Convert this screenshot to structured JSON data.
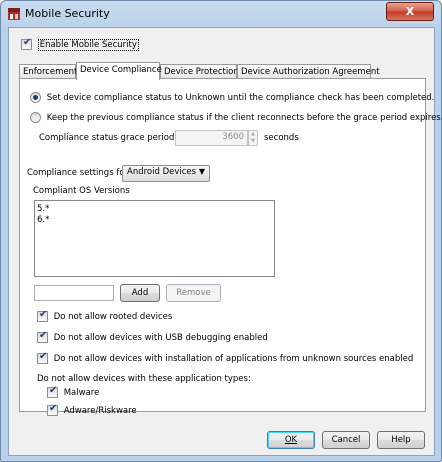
{
  "window": {
    "title": "Mobile Security",
    "close_glyph": "X"
  },
  "enable_checkbox": {
    "label": "Enable Mobile Security",
    "checked": true
  },
  "tabs": [
    {
      "label": "Enforcement",
      "active": false
    },
    {
      "label": "Device Compliance",
      "active": true
    },
    {
      "label": "Device Protection",
      "active": false
    },
    {
      "label": "Device Authorization Agreement",
      "active": false
    }
  ],
  "compliance": {
    "radio_unknown_label": "Set device compliance status to Unknown until the compliance check has been completed.",
    "radio_unknown_selected": true,
    "radio_keep_label": "Keep the previous compliance status if the client reconnects before the grace period expires.",
    "radio_keep_selected": false,
    "grace_label": "Compliance status grace period",
    "grace_value": "3600",
    "grace_unit": "seconds",
    "settings_for_label": "Compliance settings for",
    "settings_for_value": "Android Devices",
    "os_versions_label": "Compliant OS Versions",
    "os_versions": [
      "5.*",
      "6.*"
    ],
    "new_version_value": "",
    "add_label": "Add",
    "remove_label": "Remove",
    "options": [
      {
        "label": "Do not allow rooted devices",
        "checked": true
      },
      {
        "label": "Do not allow devices with USB debugging enabled",
        "checked": true
      },
      {
        "label": "Do not allow devices with installation of applications from unknown sources enabled",
        "checked": true
      }
    ],
    "app_types_label": "Do not allow devices with these application types:",
    "app_types": [
      {
        "label": "Malware",
        "checked": true
      },
      {
        "label": "Adware/Riskware",
        "checked": true
      }
    ]
  },
  "footer": {
    "ok_label": "OK",
    "cancel_label": "Cancel",
    "help_label": "Help"
  },
  "colors": {
    "title_gradient": "#b9d1ea",
    "close": "#c0392b",
    "check": "#1a3f7a"
  }
}
